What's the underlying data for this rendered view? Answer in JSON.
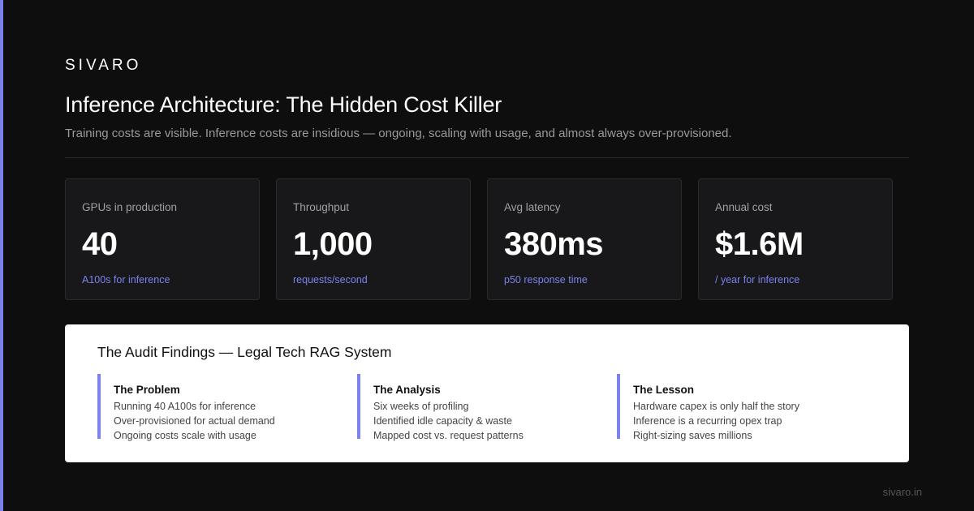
{
  "brand": "SIVARO",
  "title": "Inference Architecture: The Hidden Cost Killer",
  "subtitle": "Training costs are visible. Inference costs are insidious — ongoing, scaling with usage, and almost always over-provisioned.",
  "colors": {
    "accent": "#7b83eb",
    "background": "#0e0e0e",
    "card": "#18181a"
  },
  "stats": [
    {
      "label": "GPUs in production",
      "value": "40",
      "sub": "A100s for inference"
    },
    {
      "label": "Throughput",
      "value": "1,000",
      "sub": "requests/second"
    },
    {
      "label": "Avg latency",
      "value": "380ms",
      "sub": "p50 response time"
    },
    {
      "label": "Annual cost",
      "value": "$1.6M",
      "sub": "/ year for inference"
    }
  ],
  "findings": {
    "title": "The Audit Findings — Legal Tech RAG System",
    "columns": [
      {
        "title": "The Problem",
        "items": [
          "Running 40 A100s for inference",
          "Over-provisioned for actual demand",
          "Ongoing costs scale with usage"
        ]
      },
      {
        "title": "The Analysis",
        "items": [
          "Six weeks of profiling",
          "Identified idle capacity & waste",
          "Mapped cost vs. request patterns"
        ]
      },
      {
        "title": "The Lesson",
        "items": [
          "Hardware capex is only half the story",
          "Inference is a recurring opex trap",
          "Right-sizing saves millions"
        ]
      }
    ]
  },
  "footer": "sivaro.in"
}
